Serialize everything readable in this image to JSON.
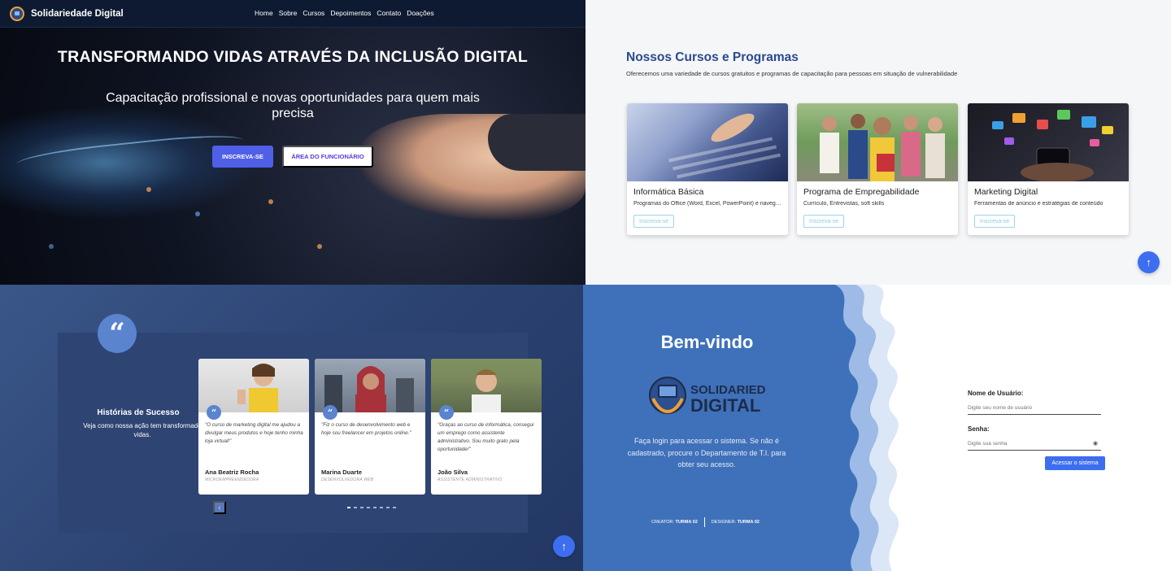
{
  "hero": {
    "brand": "Solidariedade Digital",
    "nav": [
      "Home",
      "Sobre",
      "Cursos",
      "Depoimentos",
      "Contato",
      "Doações"
    ],
    "title": "TRANSFORMANDO VIDAS ATRAVÉS DA INCLUSÃO DIGITAL",
    "subtitle": "Capacitação profissional e novas oportunidades para quem mais precisa",
    "cta_primary": "INSCREVA-SE",
    "cta_secondary": "ÁREA DO FUNCIONÁRIO"
  },
  "courses": {
    "title": "Nossos Cursos e Programas",
    "description": "Oferecemos uma variedade de cursos gratuitos e programas de capacitação para pessoas em situação de vulnerabilidade",
    "items": [
      {
        "title": "Informática Básica",
        "text": "Programas do Office (Word, Excel, PowerPoint) e navegação",
        "button": "Inscreva-se"
      },
      {
        "title": "Programa de Empregabilidade",
        "text": "Currículo, Entrevistas, soft skills",
        "button": "Inscreva-se"
      },
      {
        "title": "Marketing Digital",
        "text": "Ferramentas de anúncio e estratégias de conteúdo",
        "button": "Inscreva-se"
      }
    ],
    "scroll_icon": "arrow-up-icon"
  },
  "testimonials": {
    "quote_mark": "“",
    "title": "Histórias de Sucesso",
    "subtitle": "Veja como nossa ação tem transformado vidas.",
    "items": [
      {
        "text": "\"O curso de marketing digital me ajudou a divulgar meus produtos e hoje tenho minha loja virtual!\"",
        "name": "Ana Beatriz Rocha",
        "role": "MICROEMPREENDEDORA"
      },
      {
        "text": "\"Fiz o curso de desenvolvimento web e hoje sou freelancer em projetos online.\"",
        "name": "Marina Duarte",
        "role": "DESENVOLVEDORA WEB"
      },
      {
        "text": "\"Graças ao curso de informática, consegui um emprego como assistente administrativo. Sou muito grato pela oportunidade!\"",
        "name": "João Silva",
        "role": "ASSISTENTE ADMINISTRATIVO"
      }
    ],
    "prev_label": "‹",
    "dots_count": 8,
    "active_dot": 0
  },
  "login": {
    "welcome": "Bem-vindo",
    "logo_line1": "SOLIDARIEDADE",
    "logo_line2": "DIGITAL",
    "message": "Faça login para acessar o sistema. Se não é cadastrado, procure o Departamento de T.I. para obter seu acesso.",
    "creator_label": "CREATOR:",
    "creator_value": "TURMA 02",
    "designer_label": "DESIGNER:",
    "designer_value": "TURMA 02",
    "username_label": "Nome de Usuário:",
    "username_placeholder": "Digite seu nome de usuário",
    "password_label": "Senha:",
    "password_placeholder": "Digite sua senha",
    "submit": "Acessar o sistema"
  },
  "colors": {
    "primary": "#4f5fe8",
    "navy": "#2e4473",
    "blue": "#3f71ba",
    "accent": "#3d6ef0"
  }
}
